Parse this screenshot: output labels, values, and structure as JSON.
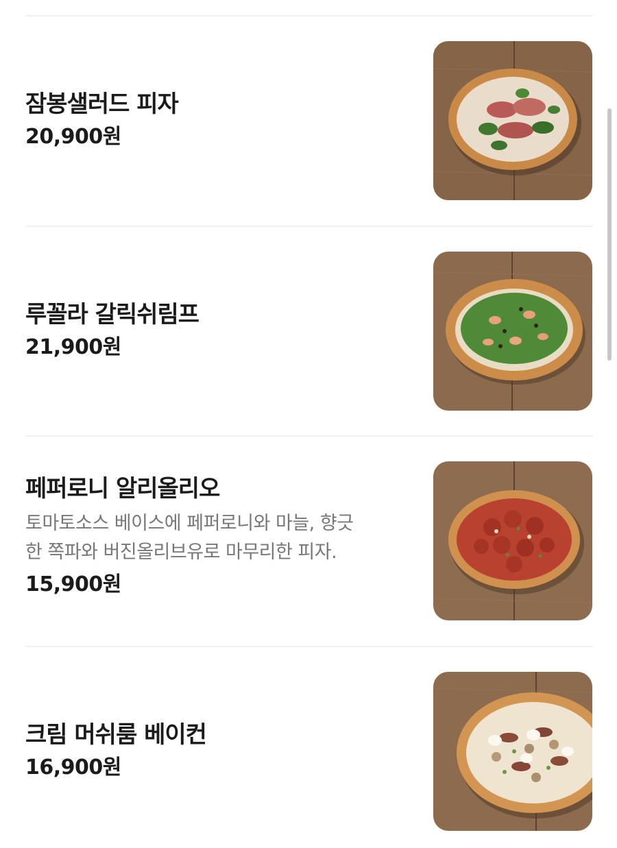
{
  "menu": {
    "items": [
      {
        "name": "잠봉샐러드 피자",
        "description": "",
        "price": "20,900원",
        "image_icon": "jambon-salad-pizza-photo"
      },
      {
        "name": "루꼴라 갈릭쉬림프",
        "description": "",
        "price": "21,900원",
        "image_icon": "arugula-garlic-shrimp-pizza-photo"
      },
      {
        "name": "페퍼로니 알리올리오",
        "description_lines": [
          "토마토소스 베이스에 페퍼로니와 마늘, 향긋",
          "한 쪽파와 버진올리브유로 마무리한 피자."
        ],
        "price": "15,900원",
        "image_icon": "pepperoni-aglio-olio-pizza-photo"
      },
      {
        "name": "크림 머쉬룸 베이컨",
        "description": "",
        "price": "16,900원",
        "image_icon": "cream-mushroom-bacon-pizza-photo"
      }
    ]
  },
  "colors": {
    "text": "#1b1b1b",
    "description": "#777777",
    "divider": "#f1f1f1",
    "wood": "#8a6a4f",
    "crust": "#c98a48"
  }
}
